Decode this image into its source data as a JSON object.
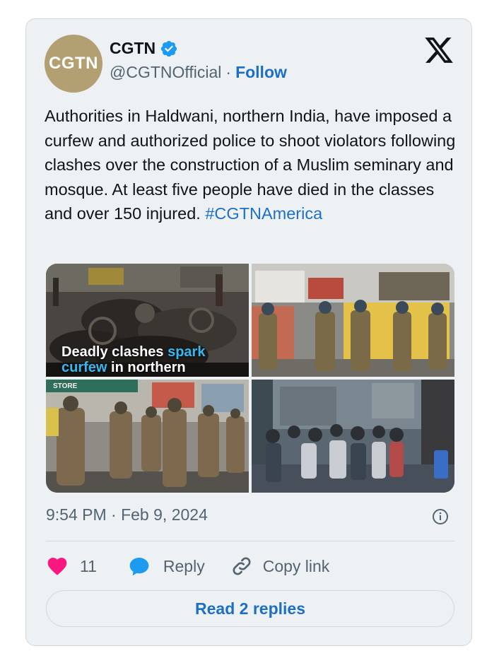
{
  "author": {
    "avatar_text": "CGTN",
    "display_name": "CGTN",
    "handle": "@CGTNOfficial",
    "separator": "·",
    "follow_label": "Follow",
    "verified_icon": "verified-badge-icon",
    "avatar_color": "#b3a072"
  },
  "platform_logo": "x-logo-icon",
  "tweet": {
    "text": "Authorities in Haldwani, northern India, have imposed a curfew and authorized police to shoot violators following clashes over the construction of a Muslim seminary and mosque. At least five people have died in the classes and over 150 injured. ",
    "hashtag": "#CGTNAmerica"
  },
  "media": {
    "overlay_text_part1": "Deadly clashes ",
    "overlay_text_accent": "spark",
    "overlay_text_line2_accent": "curfew",
    "overlay_text_line2_rest": " in northern",
    "store_sign": "STORE"
  },
  "timestamp": "9:54 PM · Feb 9, 2024",
  "actions": {
    "like_count": "11",
    "reply_label": "Reply",
    "copy_link_label": "Copy link"
  },
  "read_replies_label": "Read 2 replies",
  "colors": {
    "link": "#1d6fc6",
    "heart": "#f91880",
    "verified": "#1d9bf0",
    "card_bg": "#eef1f4"
  }
}
